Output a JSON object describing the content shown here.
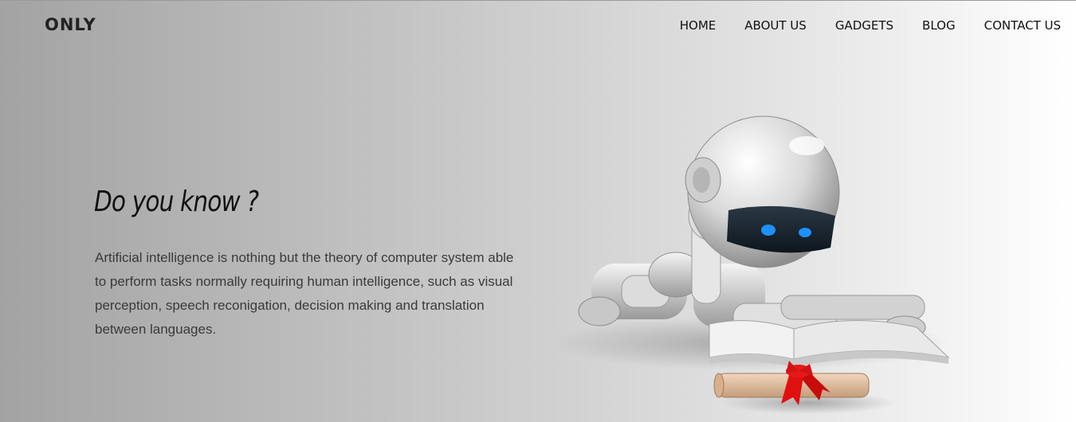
{
  "header": {
    "logo": "ONLY",
    "nav": [
      "HOME",
      "ABOUT US",
      "GADGETS",
      "BLOG",
      "CONTACT US"
    ]
  },
  "hero": {
    "title": "Do you know ?",
    "text": "Artificial intelligence is nothing but the theory of computer system able to perform tasks normally requiring human intelligence, such as visual perception, speech reconigation, decision making and translation between languages."
  },
  "colors": {
    "bg_left": "#a3a3a3",
    "bg_right": "#ffffff",
    "text_dark": "#111111",
    "robot_eye": "#1e90ff",
    "ribbon": "#e01010"
  },
  "icons": [
    "robot-illustration",
    "book-icon",
    "scroll-icon"
  ]
}
